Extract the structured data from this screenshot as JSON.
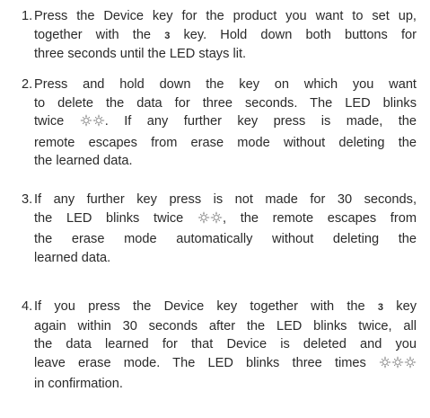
{
  "steps": [
    {
      "number": "1.",
      "l1": "Press the Device key for the product you want to set up,",
      "l2a": "together with the",
      "l2_key": "3",
      "l2b": "key. Hold down both buttons for",
      "l3": "three seconds until the LED stays lit."
    },
    {
      "number": "2.",
      "l1": "Press and hold down the key on which you want",
      "l2": "to delete the data for three seconds. The LED blinks",
      "l3a": "twice",
      "l3b": ". If any further key press is made, the",
      "l4": "remote escapes from erase mode without deleting the",
      "l5": "the learned data.",
      "blink_count": 2
    },
    {
      "number": "3.",
      "l1": "If any further key press is not made for 30 seconds,",
      "l2a": "the LED blinks twice",
      "l2b": ", the remote escapes from",
      "l3": "the erase mode automatically without deleting the",
      "l4": "learned data.",
      "blink_count": 2
    },
    {
      "number": "4.",
      "l1a": "If you press the Device key together with the",
      "l1_key": "3",
      "l1b": "key",
      "l2": "again within 30 seconds after the LED blinks twice, all",
      "l3": "the data learned for that Device is deleted and you",
      "l4": "leave erase mode. The LED blinks three times",
      "l5": "in confirmation.",
      "blink_count": 3
    }
  ],
  "icons": {
    "blink": "led-blink-icon"
  },
  "colors": {
    "text": "#2a2a2a"
  }
}
